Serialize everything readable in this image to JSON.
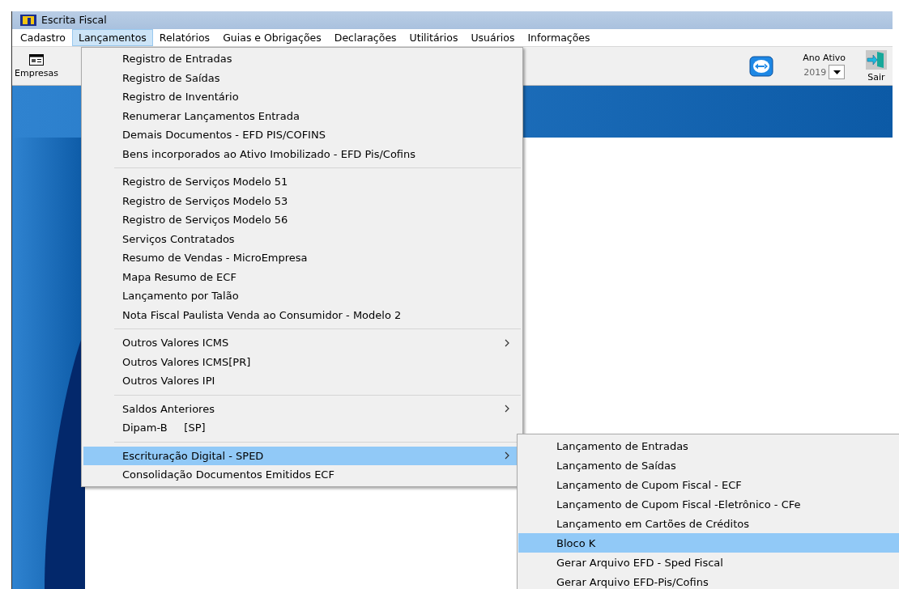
{
  "window": {
    "title": "Escrita Fiscal"
  },
  "menu_bar": [
    {
      "label": "Cadastro",
      "selected": false
    },
    {
      "label": "Lançamentos",
      "selected": true
    },
    {
      "label": "Relatórios",
      "selected": false
    },
    {
      "label": "Guias e Obrigações",
      "selected": false
    },
    {
      "label": "Declarações",
      "selected": false
    },
    {
      "label": "Utilitários",
      "selected": false
    },
    {
      "label": "Usuários",
      "selected": false
    },
    {
      "label": "Informações",
      "selected": false
    }
  ],
  "toolbar": {
    "companies_button": {
      "label": "Empresas"
    },
    "year": {
      "label": "Ano Ativo",
      "value": "2019"
    },
    "exit_button": {
      "label": "Sair"
    }
  },
  "dropdown": {
    "groups": [
      {
        "items": [
          {
            "label": "Registro de Entradas",
            "submenu": false,
            "selected": false
          },
          {
            "label": "Registro de Saídas",
            "submenu": false,
            "selected": false
          },
          {
            "label": "Registro de Inventário",
            "submenu": false,
            "selected": false
          },
          {
            "label": "Renumerar Lançamentos Entrada",
            "submenu": false,
            "selected": false
          },
          {
            "label": "Demais Documentos - EFD PIS/COFINS",
            "submenu": false,
            "selected": false
          },
          {
            "label": "Bens incorporados ao Ativo Imobilizado - EFD Pis/Cofins",
            "submenu": false,
            "selected": false
          }
        ]
      },
      {
        "items": [
          {
            "label": "Registro de Serviços Modelo 51",
            "submenu": false,
            "selected": false
          },
          {
            "label": "Registro de Serviços Modelo 53",
            "submenu": false,
            "selected": false
          },
          {
            "label": "Registro de Serviços Modelo 56",
            "submenu": false,
            "selected": false
          },
          {
            "label": "Serviços Contratados",
            "submenu": false,
            "selected": false
          },
          {
            "label": "Resumo de Vendas - MicroEmpresa",
            "submenu": false,
            "selected": false
          },
          {
            "label": "Mapa Resumo de ECF",
            "submenu": false,
            "selected": false
          },
          {
            "label": "Lançamento por Talão",
            "submenu": false,
            "selected": false
          },
          {
            "label": "Nota Fiscal Paulista Venda ao Consumidor - Modelo 2",
            "submenu": false,
            "selected": false
          }
        ]
      },
      {
        "items": [
          {
            "label": "Outros Valores ICMS",
            "submenu": true,
            "selected": false
          },
          {
            "label": "Outros Valores ICMS[PR]",
            "submenu": false,
            "selected": false
          },
          {
            "label": "Outros Valores IPI",
            "submenu": false,
            "selected": false
          }
        ]
      },
      {
        "items": [
          {
            "label": "Saldos Anteriores",
            "submenu": true,
            "selected": false
          },
          {
            "label": "Dipam-B     [SP]",
            "submenu": false,
            "selected": false
          }
        ]
      },
      {
        "items": [
          {
            "label": "Escrituração Digital - SPED",
            "submenu": true,
            "selected": true
          },
          {
            "label": "Consolidação Documentos Emitidos ECF",
            "submenu": false,
            "selected": false
          }
        ]
      }
    ]
  },
  "submenu": [
    {
      "label": "Lançamento de Entradas",
      "selected": false
    },
    {
      "label": "Lançamento de Saídas",
      "selected": false
    },
    {
      "label": "Lançamento de Cupom Fiscal - ECF",
      "selected": false
    },
    {
      "label": "Lançamento de Cupom Fiscal -Eletrônico - CFe",
      "selected": false
    },
    {
      "label": "Lançamento em Cartões de Créditos",
      "selected": false
    },
    {
      "label": "Bloco K",
      "selected": true
    },
    {
      "label": "Gerar Arquivo EFD - Sped Fiscal",
      "selected": false
    },
    {
      "label": "Gerar Arquivo EFD-Pis/Cofins",
      "selected": false
    }
  ]
}
